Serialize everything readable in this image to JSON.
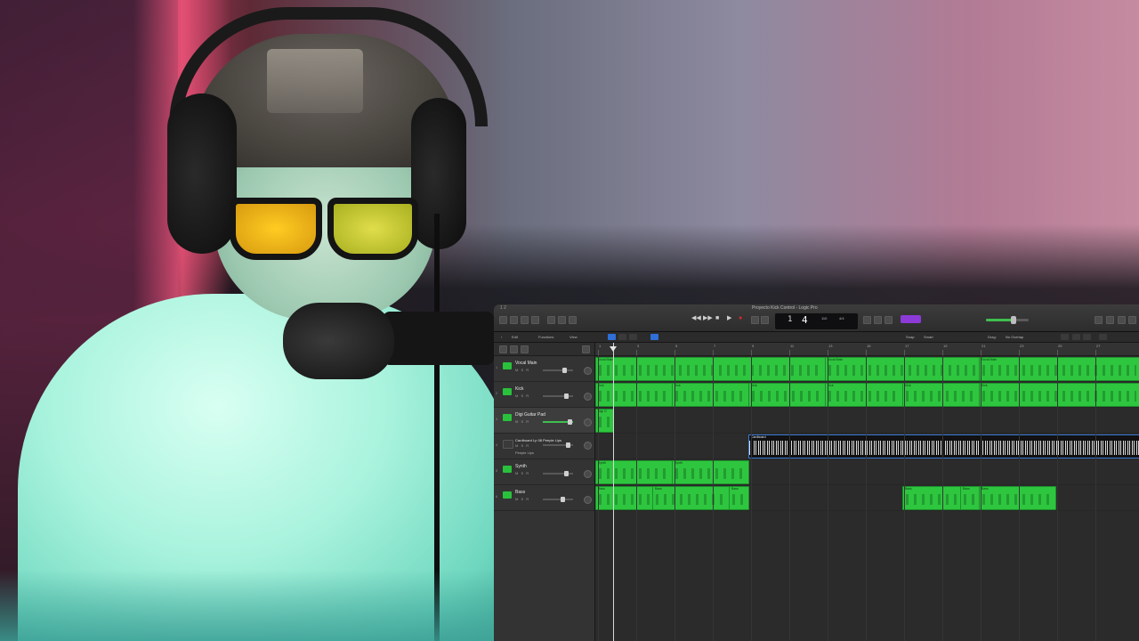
{
  "window": {
    "menu_label": "1 2",
    "title": "Proyecto Kick Control - Logic Pro"
  },
  "transport": {
    "rewind": "◀◀",
    "forward": "▶▶",
    "stop": "■",
    "play": "▶",
    "record": "●",
    "lcd_bar": "1",
    "lcd_beat": "4",
    "lcd_tempo": "110",
    "lcd_key": "Dm",
    "lcd_signature": "4/4"
  },
  "toolbar2": {
    "edit": "Edit",
    "functions": "Functions",
    "view": "View",
    "snap_label": "Snap:",
    "snap_value": "Smart",
    "drag_label": "Drag:",
    "drag_value": "No Overlap"
  },
  "ruler": [
    "1",
    "3",
    "5",
    "7",
    "9",
    "11",
    "13",
    "15",
    "17",
    "19",
    "21",
    "23",
    "25",
    "27"
  ],
  "tracks": [
    {
      "num": "1",
      "name": "Vocal Main",
      "type": "midi",
      "ms": "M S R"
    },
    {
      "num": "2",
      "name": "Kick",
      "type": "midi",
      "ms": "M S R"
    },
    {
      "num": "3",
      "name": "Digi Guitar Pad",
      "type": "midi",
      "ms": "M S R"
    },
    {
      "num": "4",
      "name": "Cardboard Lp 08 Peeple Lips",
      "type": "audio",
      "ms": "M S R",
      "sub": "Peeple Lips"
    },
    {
      "num": "5",
      "name": "Synth",
      "type": "midi",
      "ms": "M S R"
    },
    {
      "num": "6",
      "name": "Bass",
      "type": "midi",
      "ms": "M S R"
    }
  ],
  "regions": {
    "track1": [
      {
        "name": "Vocal Main",
        "start": 0,
        "end": 258
      },
      {
        "name": "Vocal Main",
        "start": 258,
        "end": 431
      },
      {
        "name": "Vocal Main",
        "start": 431,
        "end": 611
      }
    ],
    "track2": [
      {
        "name": "Kick",
        "start": 0,
        "end": 86
      },
      {
        "name": "Kick",
        "start": 86,
        "end": 172
      },
      {
        "name": "Kick",
        "start": 172,
        "end": 258
      },
      {
        "name": "Kick",
        "start": 258,
        "end": 345
      },
      {
        "name": "Kick",
        "start": 345,
        "end": 431
      },
      {
        "name": "Kick",
        "start": 431,
        "end": 611
      }
    ],
    "track3": [
      {
        "name": "Digi G",
        "start": 0,
        "end": 20
      }
    ],
    "track4": [
      {
        "name": "Cardboard",
        "start": 172,
        "end": 611
      }
    ],
    "track5": [
      {
        "name": "Synth",
        "start": 0,
        "end": 86
      },
      {
        "name": "Synth",
        "start": 86,
        "end": 172
      }
    ],
    "track6": [
      {
        "name": "Bass",
        "start": 0,
        "end": 64
      },
      {
        "name": "Bass",
        "start": 64,
        "end": 150
      },
      {
        "name": "Bass",
        "start": 150,
        "end": 172
      },
      {
        "name": "Bass",
        "start": 345,
        "end": 410
      },
      {
        "name": "Bass",
        "start": 410,
        "end": 431
      },
      {
        "name": "Bass",
        "start": 431,
        "end": 517
      }
    ]
  }
}
